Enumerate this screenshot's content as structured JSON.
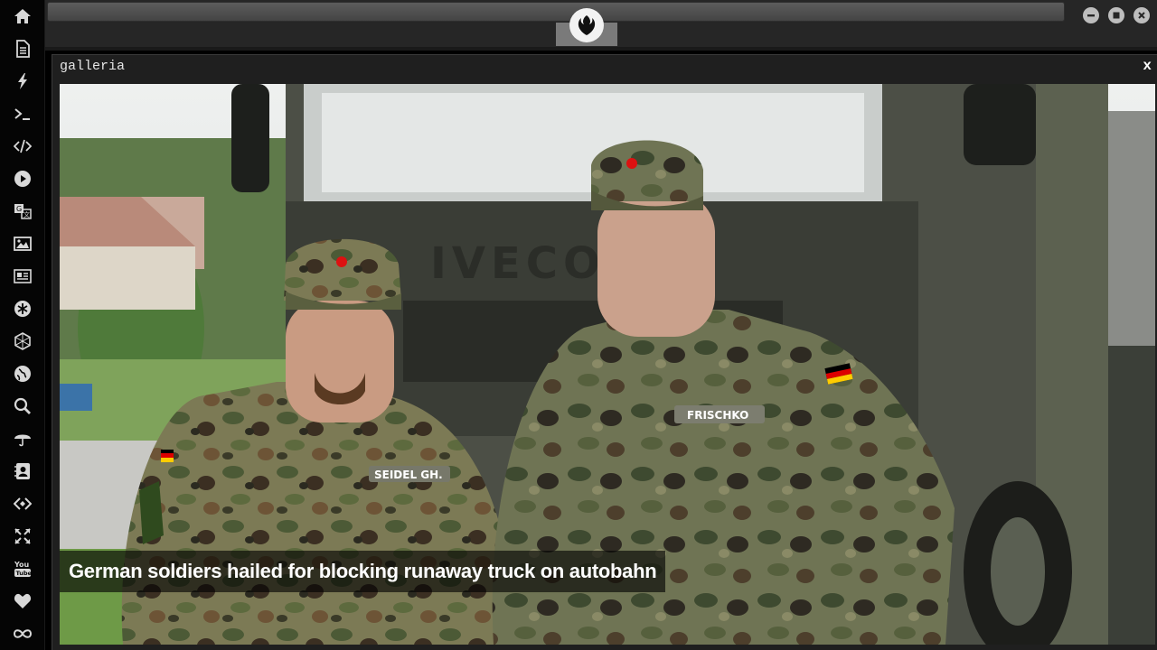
{
  "panel": {
    "title": "galleria",
    "close_label": "x"
  },
  "gallery": {
    "caption": "German soldiers hailed for blocking runaway truck on autobahn",
    "name_tape_left": "SEIDEL GH.",
    "name_tape_right": "FRISCHKO",
    "truck_grille_text": "IVECO"
  },
  "sidebar": {
    "items": [
      {
        "icon": "home-icon"
      },
      {
        "icon": "document-icon"
      },
      {
        "icon": "lightning-icon"
      },
      {
        "icon": "terminal-icon"
      },
      {
        "icon": "code-icon"
      },
      {
        "icon": "play-icon"
      },
      {
        "icon": "translate-icon"
      },
      {
        "icon": "image-icon"
      },
      {
        "icon": "newspaper-icon"
      },
      {
        "icon": "asterisk-icon"
      },
      {
        "icon": "hexagon-icon"
      },
      {
        "icon": "globe-icon"
      },
      {
        "icon": "search-icon"
      },
      {
        "icon": "umbrella-icon"
      },
      {
        "icon": "contact-icon"
      },
      {
        "icon": "code-fork-icon"
      },
      {
        "icon": "expand-icon"
      },
      {
        "icon": "youtube-icon"
      },
      {
        "icon": "heart-icon"
      },
      {
        "icon": "infinity-icon"
      }
    ]
  },
  "window_controls": [
    "minimize-icon",
    "maximize-icon",
    "close-icon"
  ],
  "colors": {
    "background": "#000000",
    "sidebar": "#050505",
    "topbar": "#262626",
    "panel": "#1f1f1f",
    "icon": "#d8d8d8",
    "caption_text": "#ffffff"
  }
}
